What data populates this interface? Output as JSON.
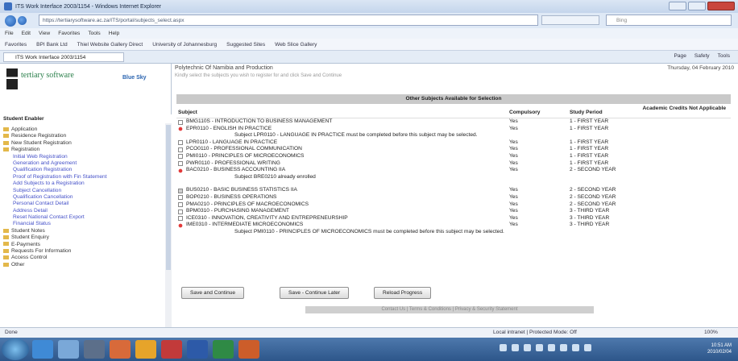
{
  "browser": {
    "title": "ITS Work Interface 2003/1154 - Windows Internet Explorer",
    "url": "https://tertiarysoftware.ac.za/ITS/portal/subjects_select.aspx",
    "search_placeholder": "Bing",
    "menu": [
      "File",
      "Edit",
      "View",
      "Favorites",
      "Tools",
      "Help"
    ],
    "favorites": [
      "Favorites",
      "BPI Bank Ltd",
      "Thiel Website Gallery Direct",
      "University of Johannesburg",
      "Suggested Sites",
      "Web Slice Gallery"
    ],
    "tab_label": "ITS Work Interface 2003/1154",
    "commands": [
      "Page",
      "Safety",
      "Tools"
    ]
  },
  "sidebar": {
    "logo_text": "tertiary software",
    "brand": "Blue Sky",
    "header": "Student Enabler",
    "items": [
      {
        "label": "Application",
        "level": "top"
      },
      {
        "label": "Residence Registration",
        "level": "top"
      },
      {
        "label": "New Student Registration",
        "level": "top"
      },
      {
        "label": "Registration",
        "level": "top"
      },
      {
        "label": "Initial Web Registration",
        "level": "sub"
      },
      {
        "label": "Generation and Agreement",
        "level": "sub"
      },
      {
        "label": "Qualification Registration",
        "level": "sub"
      },
      {
        "label": "Proof of Registration with Fin Statement",
        "level": "sub"
      },
      {
        "label": "Add Subjects to a Registration",
        "level": "sub"
      },
      {
        "label": "Subject Cancellation",
        "level": "sub"
      },
      {
        "label": "Qualification Cancellation",
        "level": "sub"
      },
      {
        "label": "Personal Contact Detail",
        "level": "sub"
      },
      {
        "label": "Address Detail",
        "level": "sub"
      },
      {
        "label": "Reset National Contact Export",
        "level": "sub"
      },
      {
        "label": "Financial Status",
        "level": "sub"
      },
      {
        "label": "Student Notes",
        "level": "top"
      },
      {
        "label": "Student Enquiry",
        "level": "top"
      },
      {
        "label": "E-Payments",
        "level": "top"
      },
      {
        "label": "Requests For Information",
        "level": "top"
      },
      {
        "label": "Access Control",
        "level": "top"
      },
      {
        "label": "Other",
        "level": "top"
      }
    ]
  },
  "page": {
    "title": "Polytechnic Of Namibia and Production",
    "subtitle": "Kindly select the subjects you wish to register for and click Save and Continue",
    "date": "Thursday, 04 February 2010",
    "section_title": "Other Subjects Available for Selection",
    "columns": [
      "Subject",
      "Compulsory",
      "Study Period",
      "Academic Credits Not Applicable"
    ],
    "rows": [
      {
        "type": "subject",
        "mark": "empty",
        "subject": "BMG110S - INTRODUCTION TO BUSINESS MANAGEMENT",
        "compulsory": "Yes",
        "period": "1 - FIRST YEAR"
      },
      {
        "type": "subject",
        "mark": "red",
        "subject": "EPR0110 - ENGLISH IN PRACTICE",
        "compulsory": "Yes",
        "period": "1 - FIRST YEAR"
      },
      {
        "type": "note",
        "text": "Subject LPR0110 - LANGUAGE IN PRACTICE must be completed before this subject may be selected."
      },
      {
        "type": "subject",
        "mark": "empty",
        "subject": "LPR0110 - LANGUAGE IN PRACTICE",
        "compulsory": "Yes",
        "period": "1 - FIRST YEAR"
      },
      {
        "type": "subject",
        "mark": "empty",
        "subject": "PCO0110 - PROFESSIONAL COMMUNICATION",
        "compulsory": "Yes",
        "period": "1 - FIRST YEAR"
      },
      {
        "type": "subject",
        "mark": "empty",
        "subject": "PMI0110 - PRINCIPLES OF MICROECONOMICS",
        "compulsory": "Yes",
        "period": "1 - FIRST YEAR"
      },
      {
        "type": "subject",
        "mark": "empty",
        "subject": "PWR0110 - PROFESSIONAL WRITING",
        "compulsory": "Yes",
        "period": "1 - FIRST YEAR"
      },
      {
        "type": "subject",
        "mark": "red",
        "subject": "BAC0210 - BUSINESS ACCOUNTING IIA",
        "compulsory": "Yes",
        "period": "2 - SECOND YEAR"
      },
      {
        "type": "note",
        "text": "Subject BRE0210 already enrolled"
      },
      {
        "type": "spacer"
      },
      {
        "type": "subject",
        "mark": "grey",
        "subject": "BUS0210 - BASIC BUSINESS STATISTICS IIA",
        "compulsory": "Yes",
        "period": "2 - SECOND YEAR"
      },
      {
        "type": "subject",
        "mark": "empty",
        "subject": "BOP0210 - BUSINESS OPERATIONS",
        "compulsory": "Yes",
        "period": "2 - SECOND YEAR"
      },
      {
        "type": "subject",
        "mark": "empty",
        "subject": "PMA0210 - PRINCIPLES OF MACROECONOMICS",
        "compulsory": "Yes",
        "period": "2 - SECOND YEAR"
      },
      {
        "type": "subject",
        "mark": "empty",
        "subject": "BPM0310 - PURCHASING MANAGEMENT",
        "compulsory": "Yes",
        "period": "3 - THIRD YEAR"
      },
      {
        "type": "subject",
        "mark": "empty",
        "subject": "ICE0310 - INNOVATION, CREATIVITY AND ENTREPRENEURSHIP",
        "compulsory": "Yes",
        "period": "3 - THIRD YEAR"
      },
      {
        "type": "subject",
        "mark": "red",
        "subject": "IME0310 - INTERMEDIATE MICROECONOMICS",
        "compulsory": "Yes",
        "period": "3 - THIRD YEAR"
      },
      {
        "type": "note",
        "text": "Subject PMI0110 - PRINCIPLES OF MICROECONOMICS must be completed before this subject may be selected."
      }
    ],
    "buttons": [
      "Save and Continue",
      "Save - Continue Later",
      "Reload Progress"
    ],
    "footer": "Contact Us | Terms & Conditions | Privacy & Security Statement"
  },
  "status": {
    "left": "Done",
    "zone": "Local intranet | Protected Mode: Off",
    "zoom": "100%"
  },
  "clock": {
    "time": "10:51 AM",
    "date": "2010/02/04"
  }
}
